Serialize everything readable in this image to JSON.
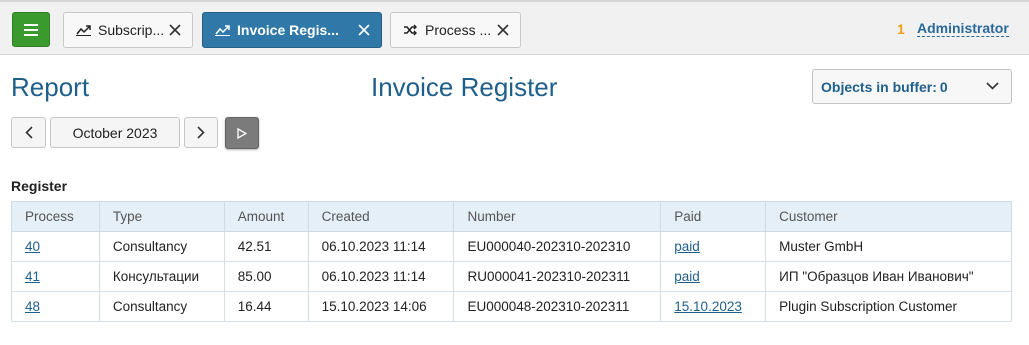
{
  "tabs": [
    {
      "label": "Subscrip...",
      "icon": "trend-chart-icon",
      "active": false
    },
    {
      "label": "Invoice Regis...",
      "icon": "trend-chart-icon",
      "active": true
    },
    {
      "label": "Process ...",
      "icon": "shuffle-icon",
      "active": false
    }
  ],
  "user": {
    "notification_count": "1",
    "name": "Administrator"
  },
  "header": {
    "report_label": "Report",
    "title": "Invoice Register",
    "buffer_label": "Objects in buffer:",
    "buffer_count": "0"
  },
  "period": {
    "label": "October 2023"
  },
  "register": {
    "title": "Register",
    "columns": [
      "Process",
      "Type",
      "Amount",
      "Created",
      "Number",
      "Paid",
      "Customer"
    ],
    "rows": [
      {
        "process": "40",
        "type": "Consultancy",
        "amount": "42.51",
        "created": "06.10.2023 11:14",
        "number": "EU000040-202310-202310",
        "paid": "paid",
        "customer": "Muster GmbH"
      },
      {
        "process": "41",
        "type": "Консультации",
        "amount": "85.00",
        "created": "06.10.2023 11:14",
        "number": "RU000041-202310-202311",
        "paid": "paid",
        "customer": "ИП \"Образцов Иван Иванович\""
      },
      {
        "process": "48",
        "type": "Consultancy",
        "amount": "16.44",
        "created": "15.10.2023 14:06",
        "number": "EU000048-202310-202311",
        "paid": "15.10.2023",
        "customer": "Plugin Subscription Customer"
      }
    ]
  },
  "colors": {
    "accent": "#1f5f8b",
    "menu": "#3a9a2e",
    "active_tab": "#2f78a7",
    "badge": "#e8a317"
  }
}
